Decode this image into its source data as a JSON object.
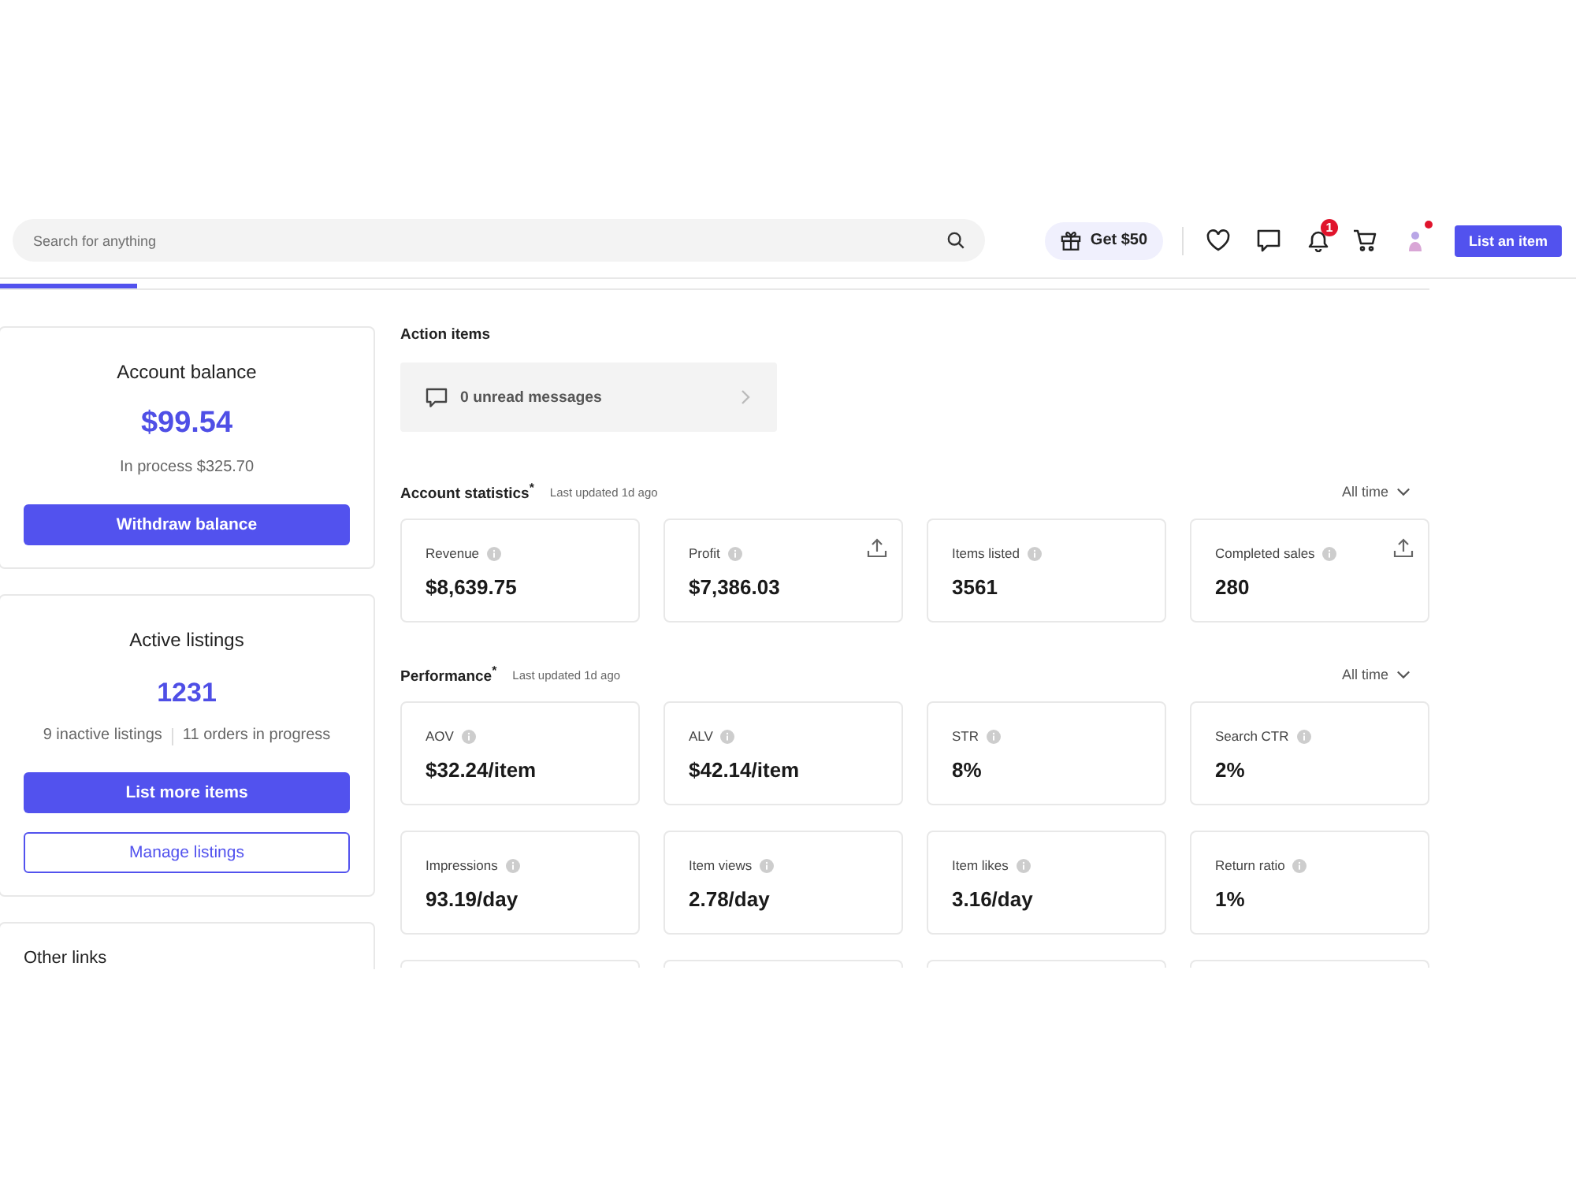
{
  "header": {
    "search": {
      "placeholder": "Search for anything"
    },
    "promo_button": {
      "label": "Get $50"
    },
    "notifications_badge": "1",
    "avatar": {
      "unread_dot": true
    },
    "list_button": {
      "label": "List an item"
    }
  },
  "tab_strip": {
    "tabs": [
      {
        "selected": true
      }
    ]
  },
  "account_balance": {
    "title": "Account balance",
    "amount": "$99.54",
    "in_process": "In process $325.70",
    "button": {
      "label": "Withdraw balance",
      "kind": "primary"
    }
  },
  "active_listings": {
    "title": "Active listings",
    "count": "1231",
    "details": [
      "9 inactive listings",
      "11 orders in progress"
    ],
    "buttons": [
      {
        "label": "List more items",
        "kind": "primary"
      },
      {
        "label": "Manage listings",
        "kind": "outline"
      }
    ]
  },
  "other_links": {
    "title": "Other links"
  },
  "action_items": {
    "title": "Action items",
    "items": [
      {
        "label": "0 unread messages"
      }
    ]
  },
  "account_statistics": {
    "title": "Account statistics$^{*}$",
    "updated": "Last updated 1d ago",
    "range": "All time",
    "cards": [
      {
        "label": "Revenue",
        "value": "$8,639.75",
        "export_button": false
      },
      {
        "label": "Profit",
        "value": "$7,386.03",
        "export_button": true
      },
      {
        "label": "Items listed",
        "value": "3561",
        "export_button": false
      },
      {
        "label": "Completed sales",
        "value": "280",
        "export_button": true
      }
    ]
  },
  "performance": {
    "title": "Performance$^{*}$",
    "updated": "Last updated 1d ago",
    "range": "All time",
    "cards": [
      {
        "label": "AOV",
        "value": "$32.24/item",
        "export_button": false
      },
      {
        "label": "ALV",
        "value": "$42.14/item",
        "export_button": false
      },
      {
        "label": "STR",
        "value": "8%",
        "export_button": false
      },
      {
        "label": "Search CTR",
        "value": "2%",
        "export_button": false
      },
      {
        "label": "Impressions",
        "value": "93.19/day",
        "export_button": false
      },
      {
        "label": "Item views",
        "value": "2.78/day",
        "export_button": false
      },
      {
        "label": "Item likes",
        "value": "3.16/day",
        "export_button": false
      },
      {
        "label": "Return ratio",
        "value": "1%",
        "export_button": false
      }
    ]
  }
}
